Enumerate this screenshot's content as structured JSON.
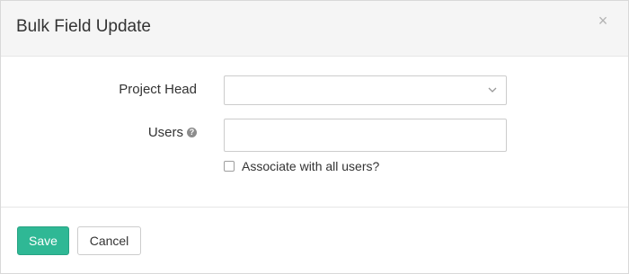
{
  "dialog": {
    "title": "Bulk Field Update",
    "close_symbol": "×"
  },
  "form": {
    "project_head": {
      "label": "Project Head",
      "selected_value": "",
      "icon": "chevron-down-icon"
    },
    "users": {
      "label": "Users",
      "help_symbol": "?",
      "value": "",
      "placeholder": ""
    },
    "associate_all": {
      "label": "Associate with all users?",
      "checked": false
    }
  },
  "footer": {
    "save_label": "Save",
    "cancel_label": "Cancel"
  },
  "colors": {
    "primary": "#2fb895",
    "header_bg": "#f5f5f5",
    "border": "#cccccc"
  }
}
